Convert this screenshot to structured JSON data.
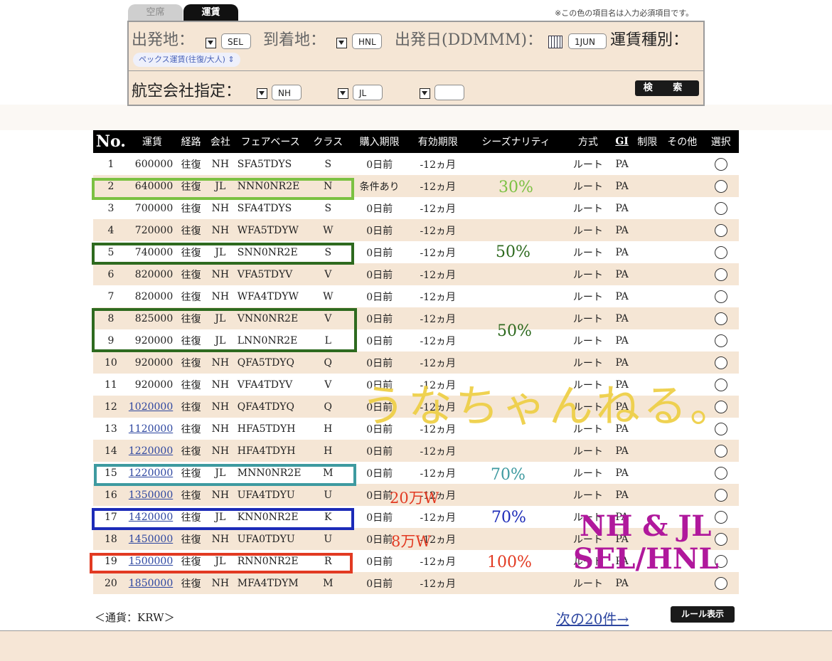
{
  "tabs": {
    "seat": "空席",
    "fare": "運賃"
  },
  "required_note": "※この色の項目名は入力必須項目です。",
  "form": {
    "departure_label": "出発地：",
    "departure_value": "SEL",
    "arrival_label": "到着地：",
    "arrival_value": "HNL",
    "date_label": "出発日(DDMMM)：",
    "date_value": "1JUN",
    "fare_type_label": "運賃種別：",
    "fare_type_value": "ペックス運賃(往復/大人) ⇕",
    "airline_label": "航空会社指定：",
    "airline_1": "NH",
    "airline_2": "JL",
    "airline_3": "",
    "search_label": "検 索"
  },
  "table": {
    "headers": [
      "No.",
      "運賃",
      "経路",
      "会社",
      "フェアベース",
      "クラス",
      "購入期限",
      "有効期限",
      "シーズナリティ",
      "方式",
      "GI",
      "制限",
      "その他",
      "選択"
    ],
    "rows": [
      {
        "no": "1",
        "fare": "600000",
        "route": "往復",
        "airline": "NH",
        "fare_basis": "SFA5TDYS",
        "class": "S",
        "purchase": "0日前",
        "validity": "-12ヵ月",
        "method": "ルート",
        "gi": "PA"
      },
      {
        "no": "2",
        "fare": "640000",
        "route": "往復",
        "airline": "JL",
        "fare_basis": "NNN0NR2E",
        "class": "N",
        "purchase": "条件あり",
        "validity": "-12ヵ月",
        "method": "ルート",
        "gi": "PA"
      },
      {
        "no": "3",
        "fare": "700000",
        "route": "往復",
        "airline": "NH",
        "fare_basis": "SFA4TDYS",
        "class": "S",
        "purchase": "0日前",
        "validity": "-12ヵ月",
        "method": "ルート",
        "gi": "PA"
      },
      {
        "no": "4",
        "fare": "720000",
        "route": "往復",
        "airline": "NH",
        "fare_basis": "WFA5TDYW",
        "class": "W",
        "purchase": "0日前",
        "validity": "-12ヵ月",
        "method": "ルート",
        "gi": "PA"
      },
      {
        "no": "5",
        "fare": "740000",
        "route": "往復",
        "airline": "JL",
        "fare_basis": "SNN0NR2E",
        "class": "S",
        "purchase": "0日前",
        "validity": "-12ヵ月",
        "method": "ルート",
        "gi": "PA"
      },
      {
        "no": "6",
        "fare": "820000",
        "route": "往復",
        "airline": "NH",
        "fare_basis": "VFA5TDYV",
        "class": "V",
        "purchase": "0日前",
        "validity": "-12ヵ月",
        "method": "ルート",
        "gi": "PA"
      },
      {
        "no": "7",
        "fare": "820000",
        "route": "往復",
        "airline": "NH",
        "fare_basis": "WFA4TDYW",
        "class": "W",
        "purchase": "0日前",
        "validity": "-12ヵ月",
        "method": "ルート",
        "gi": "PA"
      },
      {
        "no": "8",
        "fare": "825000",
        "route": "往復",
        "airline": "JL",
        "fare_basis": "VNN0NR2E",
        "class": "V",
        "purchase": "0日前",
        "validity": "-12ヵ月",
        "method": "ルート",
        "gi": "PA"
      },
      {
        "no": "9",
        "fare": "920000",
        "route": "往復",
        "airline": "JL",
        "fare_basis": "LNN0NR2E",
        "class": "L",
        "purchase": "0日前",
        "validity": "-12ヵ月",
        "method": "ルート",
        "gi": "PA"
      },
      {
        "no": "10",
        "fare": "920000",
        "route": "往復",
        "airline": "NH",
        "fare_basis": "QFA5TDYQ",
        "class": "Q",
        "purchase": "0日前",
        "validity": "-12ヵ月",
        "method": "ルート",
        "gi": "PA"
      },
      {
        "no": "11",
        "fare": "920000",
        "route": "往復",
        "airline": "NH",
        "fare_basis": "VFA4TDYV",
        "class": "V",
        "purchase": "0日前",
        "validity": "-12ヵ月",
        "method": "ルート",
        "gi": "PA"
      },
      {
        "no": "12",
        "fare": "1020000",
        "route": "往復",
        "airline": "NH",
        "fare_basis": "QFA4TDYQ",
        "class": "Q",
        "purchase": "0日前",
        "validity": "-12ヵ月",
        "method": "ルート",
        "gi": "PA"
      },
      {
        "no": "13",
        "fare": "1120000",
        "route": "往復",
        "airline": "NH",
        "fare_basis": "HFA5TDYH",
        "class": "H",
        "purchase": "0日前",
        "validity": "-12ヵ月",
        "method": "ルート",
        "gi": "PA"
      },
      {
        "no": "14",
        "fare": "1220000",
        "route": "往復",
        "airline": "NH",
        "fare_basis": "HFA4TDYH",
        "class": "H",
        "purchase": "0日前",
        "validity": "-12ヵ月",
        "method": "ルート",
        "gi": "PA"
      },
      {
        "no": "15",
        "fare": "1220000",
        "route": "往復",
        "airline": "JL",
        "fare_basis": "MNN0NR2E",
        "class": "M",
        "purchase": "0日前",
        "validity": "-12ヵ月",
        "method": "ルート",
        "gi": "PA"
      },
      {
        "no": "16",
        "fare": "1350000",
        "route": "往復",
        "airline": "NH",
        "fare_basis": "UFA4TDYU",
        "class": "U",
        "purchase": "0日前",
        "validity": "-12ヵ月",
        "method": "ルート",
        "gi": "PA"
      },
      {
        "no": "17",
        "fare": "1420000",
        "route": "往復",
        "airline": "JL",
        "fare_basis": "KNN0NR2E",
        "class": "K",
        "purchase": "0日前",
        "validity": "-12ヵ月",
        "method": "ルート",
        "gi": "PA"
      },
      {
        "no": "18",
        "fare": "1450000",
        "route": "往復",
        "airline": "NH",
        "fare_basis": "UFA0TDYU",
        "class": "U",
        "purchase": "0日前",
        "validity": "-12ヵ月",
        "method": "ルート",
        "gi": "PA"
      },
      {
        "no": "19",
        "fare": "1500000",
        "route": "往復",
        "airline": "JL",
        "fare_basis": "RNN0NR2E",
        "class": "R",
        "purchase": "0日前",
        "validity": "-12ヵ月",
        "method": "ルート",
        "gi": "PA"
      },
      {
        "no": "20",
        "fare": "1850000",
        "route": "往復",
        "airline": "NH",
        "fare_basis": "MFA4TDYM",
        "class": "M",
        "purchase": "0日前",
        "validity": "-12ヵ月",
        "method": "ルート",
        "gi": "PA"
      }
    ]
  },
  "annotations": {
    "seasonality": [
      "30%",
      "50%",
      "50%",
      "70%",
      "70%",
      "100%"
    ],
    "seasonality_colors": [
      "#7bc142",
      "#2e6a1f",
      "#2e6a1f",
      "#3e9aa0",
      "#1c2bb8",
      "#e23a22"
    ],
    "watermark": "うなちゃんねる。",
    "price_notes": [
      "20万W",
      "8万W"
    ],
    "route_title": "NH & JL",
    "route_subtitle": "SEL/HNL"
  },
  "footer": {
    "currency": "＜通貨：KRW＞",
    "next_link": "次の20件→",
    "rule_button": "ルール表示"
  }
}
